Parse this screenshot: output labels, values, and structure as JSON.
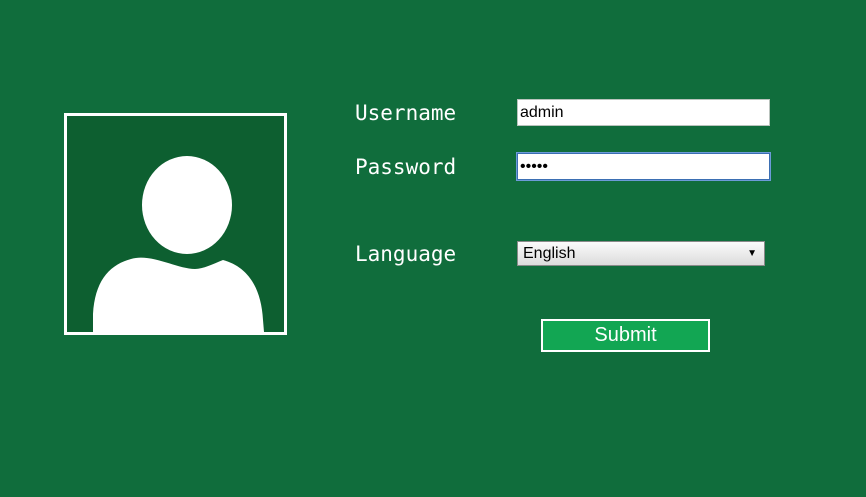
{
  "form": {
    "username_label": "Username",
    "username_value": "admin",
    "password_label": "Password",
    "password_value": "•••••",
    "language_label": "Language",
    "language_selected": "English",
    "submit_label": "Submit"
  },
  "icons": {
    "avatar": "user-silhouette-icon",
    "select_arrow": "dropdown-arrow-icon"
  },
  "colors": {
    "background": "#106d3c",
    "avatar_background": "#0d5f30",
    "submit_background": "#12a653",
    "text": "#ffffff"
  }
}
